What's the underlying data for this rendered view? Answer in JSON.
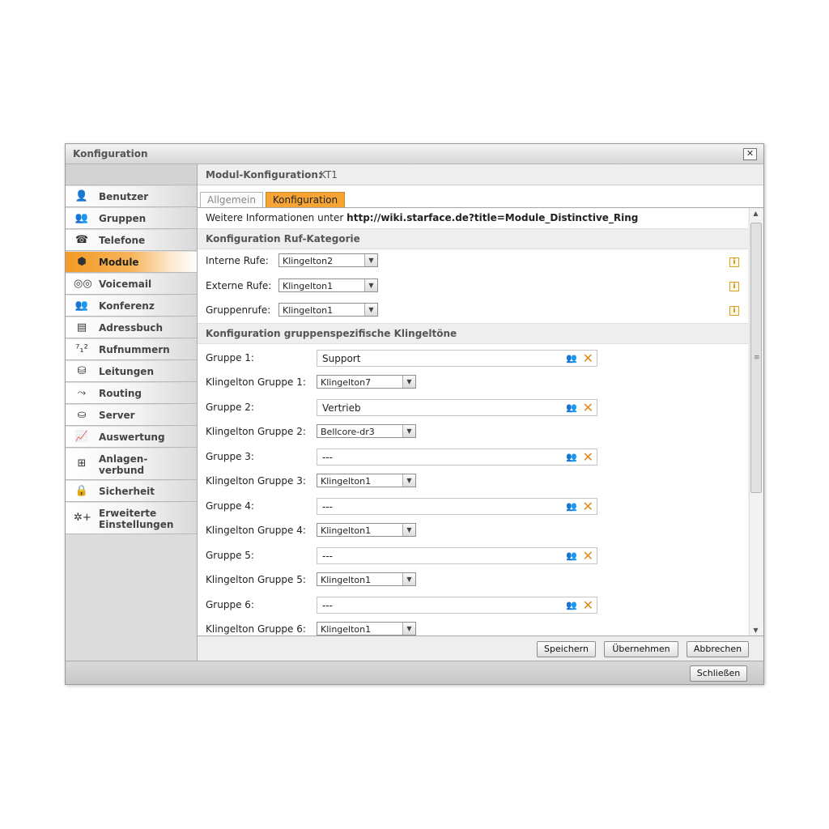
{
  "window": {
    "title": "Konfiguration",
    "close_symbol": "✕"
  },
  "sidebar": {
    "items": [
      {
        "label": "Benutzer",
        "icon": "user-icon",
        "glyph": "👤"
      },
      {
        "label": "Gruppen",
        "icon": "group-icon",
        "glyph": "👥"
      },
      {
        "label": "Telefone",
        "icon": "phone-icon",
        "glyph": "☎"
      },
      {
        "label": "Module",
        "icon": "module-cube-icon",
        "glyph": "⬢",
        "active": true
      },
      {
        "label": "Voicemail",
        "icon": "voicemail-icon",
        "glyph": "◎◎"
      },
      {
        "label": "Konferenz",
        "icon": "conference-icon",
        "glyph": "👥"
      },
      {
        "label": "Adressbuch",
        "icon": "addressbook-icon",
        "glyph": "▤"
      },
      {
        "label": "Rufnummern",
        "icon": "phone-number-icon",
        "glyph": "⁷₁²"
      },
      {
        "label": "Leitungen",
        "icon": "line-plug-icon",
        "glyph": "⛁"
      },
      {
        "label": "Routing",
        "icon": "routing-icon",
        "glyph": "⤳"
      },
      {
        "label": "Server",
        "icon": "server-icon",
        "glyph": "⛀"
      },
      {
        "label": "Auswertung",
        "icon": "chart-icon",
        "glyph": "📈"
      },
      {
        "label": "Anlagen-verbund",
        "line1": "Anlagen-",
        "line2": "verbund",
        "icon": "network-icon",
        "glyph": "⊞"
      },
      {
        "label": "Sicherheit",
        "icon": "lock-icon",
        "glyph": "🔒"
      },
      {
        "label": "Erweiterte Einstellungen",
        "line1": "Erweiterte",
        "line2": "Einstellungen",
        "icon": "advanced-settings-icon",
        "glyph": "✲+"
      }
    ]
  },
  "module_header": {
    "label": "Modul-Konfiguration:",
    "value": "KT1"
  },
  "tabs": [
    {
      "label": "Allgemein"
    },
    {
      "label": "Konfiguration",
      "active": true
    }
  ],
  "info": {
    "prefix": "Weitere Informationen unter",
    "link": "http://wiki.starface.de?title=Module_Distinctive_Ring"
  },
  "section_ruf": {
    "title": "Konfiguration Ruf-Kategorie",
    "rows": [
      {
        "label": "Interne Rufe:",
        "value": "Klingelton2"
      },
      {
        "label": "Externe Rufe:",
        "value": "Klingelton1"
      },
      {
        "label": "Gruppenrufe:",
        "value": "Klingelton1"
      }
    ],
    "info_symbol": "i"
  },
  "section_groups": {
    "title": "Konfiguration gruppenspezifische Klingeltöne",
    "groups": [
      {
        "label": "Gruppe 1:",
        "value": "Support",
        "tone_label": "Klingelton Gruppe 1:",
        "tone": "Klingelton7"
      },
      {
        "label": "Gruppe 2:",
        "value": "Vertrieb",
        "tone_label": "Klingelton Gruppe 2:",
        "tone": "Bellcore-dr3"
      },
      {
        "label": "Gruppe 3:",
        "value": "---",
        "tone_label": "Klingelton Gruppe 3:",
        "tone": "Klingelton1"
      },
      {
        "label": "Gruppe 4:",
        "value": "---",
        "tone_label": "Klingelton Gruppe 4:",
        "tone": "Klingelton1"
      },
      {
        "label": "Gruppe 5:",
        "value": "---",
        "tone_label": "Klingelton Gruppe 5:",
        "tone": "Klingelton1"
      },
      {
        "label": "Gruppe 6:",
        "value": "---",
        "tone_label": "Klingelton Gruppe 6:",
        "tone": "Klingelton1"
      }
    ]
  },
  "buttons": {
    "save": "Speichern",
    "apply": "Übernehmen",
    "cancel": "Abbrechen",
    "close": "Schließen"
  },
  "colors": {
    "accent": "#f6a535",
    "window_bg": "#f2f2f2",
    "section_bg": "#eeeeee",
    "delete_icon": "#e08a1c"
  }
}
